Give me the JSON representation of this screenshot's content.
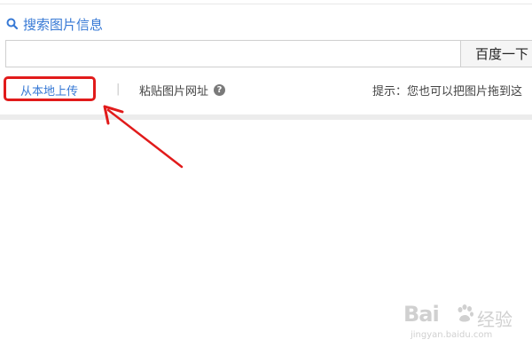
{
  "header": {
    "title": "搜索图片信息",
    "icon": "search-icon"
  },
  "search": {
    "value": "",
    "placeholder": "",
    "button_label": "百度一下"
  },
  "options": {
    "upload_local": "从本地上传",
    "divider": "|",
    "paste_url": "粘贴图片网址",
    "help_icon": "question-icon",
    "hint": "提示：您也可以把图片拖到这"
  },
  "annotation": {
    "highlight_color": "#e11b1b"
  },
  "watermark": {
    "brand": "Bai",
    "suffix": "经验",
    "url": "jingyan.baidu.com"
  },
  "colors": {
    "accent": "#3779d5",
    "highlight": "#e11b1b"
  }
}
